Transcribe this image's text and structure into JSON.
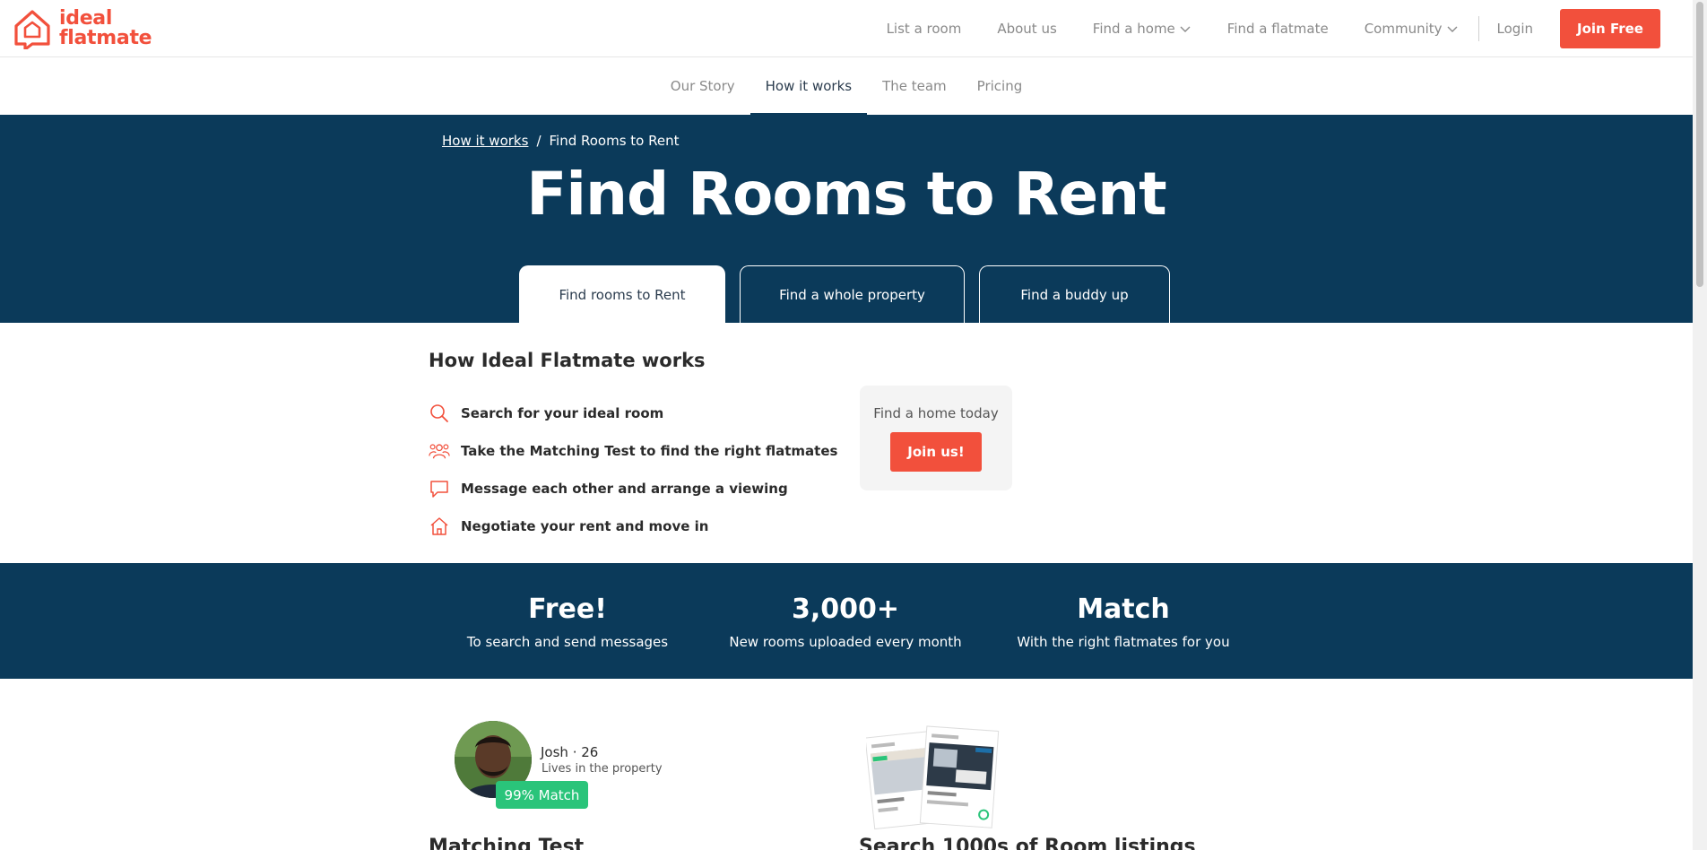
{
  "brand": {
    "logo_line1": "ideal",
    "logo_line2": "flatmate",
    "accent": "#f2503c",
    "navy": "#0b3a5a"
  },
  "nav": {
    "list_room": "List a room",
    "about": "About us",
    "find_home": "Find a home",
    "find_flatmate": "Find a flatmate",
    "community": "Community",
    "login": "Login",
    "join_free": "Join Free"
  },
  "subnav": {
    "items": [
      "Our Story",
      "How it works",
      "The team",
      "Pricing"
    ],
    "active": "How it works"
  },
  "hero": {
    "breadcrumb_link": "How it works",
    "breadcrumb_sep": "/",
    "breadcrumb_current": "Find Rooms to Rent",
    "title": "Find Rooms to Rent",
    "tabs": [
      "Find rooms to Rent",
      "Find a whole property",
      "Find a buddy up"
    ]
  },
  "how": {
    "title": "How Ideal Flatmate works",
    "steps": [
      {
        "icon": "search-icon",
        "text": "Search for your ideal room"
      },
      {
        "icon": "people-icon",
        "text": "Take the Matching Test to find the right flatmates"
      },
      {
        "icon": "chat-icon",
        "text": "Message each other and arrange a viewing"
      },
      {
        "icon": "home-icon",
        "text": "Negotiate your rent and move in"
      }
    ],
    "cta_text": "Find a home today",
    "cta_button": "Join us!"
  },
  "stats": [
    {
      "title": "Free!",
      "sub": "To search and send messages"
    },
    {
      "title": "3,000+",
      "sub": "New rooms uploaded every month"
    },
    {
      "title": "Match",
      "sub": "With the right flatmates for you"
    }
  ],
  "feature": {
    "person_name": "Josh · 26",
    "person_sub": "Lives in the property",
    "match": "99% Match",
    "heading_left": "Matching Test",
    "heading_right": "Search 1000s of Room listings"
  }
}
